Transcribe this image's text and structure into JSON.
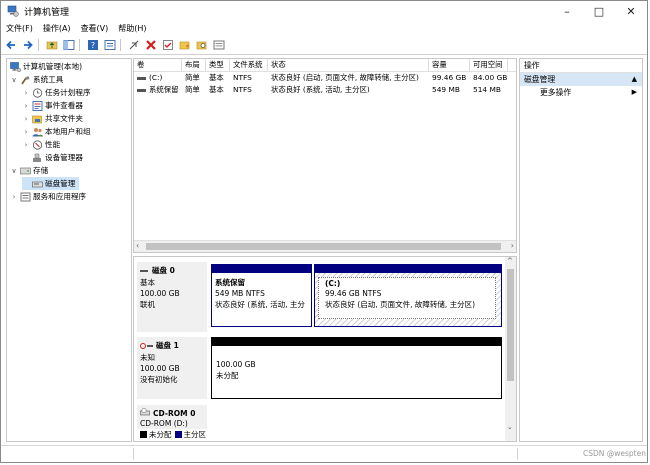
{
  "window": {
    "title": "计算机管理",
    "buttons": {
      "minimize": "–",
      "maximize": "□",
      "close": "✕"
    }
  },
  "menu": [
    "文件(F)",
    "操作(A)",
    "查看(V)",
    "帮助(H)"
  ],
  "tree": [
    {
      "label": "计算机管理(本地)",
      "indent": 0,
      "chevron": "",
      "icon": "computer-icon"
    },
    {
      "label": "系统工具",
      "indent": 1,
      "chevron": "∨",
      "icon": "tools-icon"
    },
    {
      "label": "任务计划程序",
      "indent": 2,
      "chevron": "›",
      "icon": "clock-icon"
    },
    {
      "label": "事件查看器",
      "indent": 2,
      "chevron": "›",
      "icon": "event-viewer-icon"
    },
    {
      "label": "共享文件夹",
      "indent": 2,
      "chevron": "›",
      "icon": "shared-folder-icon"
    },
    {
      "label": "本地用户和组",
      "indent": 2,
      "chevron": "›",
      "icon": "users-icon"
    },
    {
      "label": "性能",
      "indent": 2,
      "chevron": "›",
      "icon": "performance-icon"
    },
    {
      "label": "设备管理器",
      "indent": 2,
      "chevron": "",
      "icon": "device-manager-icon"
    },
    {
      "label": "存储",
      "indent": 1,
      "chevron": "∨",
      "icon": "storage-icon"
    },
    {
      "label": "磁盘管理",
      "indent": 2,
      "chevron": "",
      "icon": "disk-management-icon",
      "selected": true
    },
    {
      "label": "服务和应用程序",
      "indent": 1,
      "chevron": "›",
      "icon": "services-icon"
    }
  ],
  "volumes": {
    "columns": [
      "卷",
      "布局",
      "类型",
      "文件系统",
      "状态",
      "容量",
      "可用空间"
    ],
    "rows": [
      [
        "(C:)",
        "简单",
        "基本",
        "NTFS",
        "状态良好 (启动, 页面文件, 故障转储, 主分区)",
        "99.46 GB",
        "84.00 GB"
      ],
      [
        "系统保留",
        "简单",
        "基本",
        "NTFS",
        "状态良好 (系统, 活动, 主分区)",
        "549 MB",
        "514 MB"
      ]
    ],
    "scroll_left": "‹",
    "scroll_right": "›"
  },
  "disks": [
    {
      "name": "磁盘 0",
      "type": "基本",
      "size": "100.00 GB",
      "state": "联机",
      "partitions": [
        {
          "name": "系统保留",
          "detail": "549 MB NTFS",
          "status": "状态良好 (系统, 活动, 主分"
        },
        {
          "name": "(C:)",
          "detail": "99.46 GB NTFS",
          "status": "状态良好 (启动, 页面文件, 故障转储, 主分区)"
        }
      ]
    },
    {
      "name": "磁盘 1",
      "type": "未知",
      "size": "100.00 GB",
      "state": "没有初始化",
      "partitions": [
        {
          "name": "",
          "detail": "100.00 GB",
          "status": "未分配"
        }
      ]
    },
    {
      "name": "CD-ROM 0",
      "type": "CD-ROM (D:)",
      "size": "",
      "state": "",
      "partitions": []
    }
  ],
  "legend": [
    {
      "label": "未分配",
      "color": "#000000"
    },
    {
      "label": "主分区",
      "color": "#000080"
    }
  ],
  "actions": {
    "header": "操作",
    "section": "磁盘管理",
    "items": [
      "更多操作"
    ]
  },
  "watermark": "CSDN @wespten",
  "colors": {
    "primary_partition": "#000080",
    "unallocated": "#000000",
    "selection": "#cde3f7"
  }
}
